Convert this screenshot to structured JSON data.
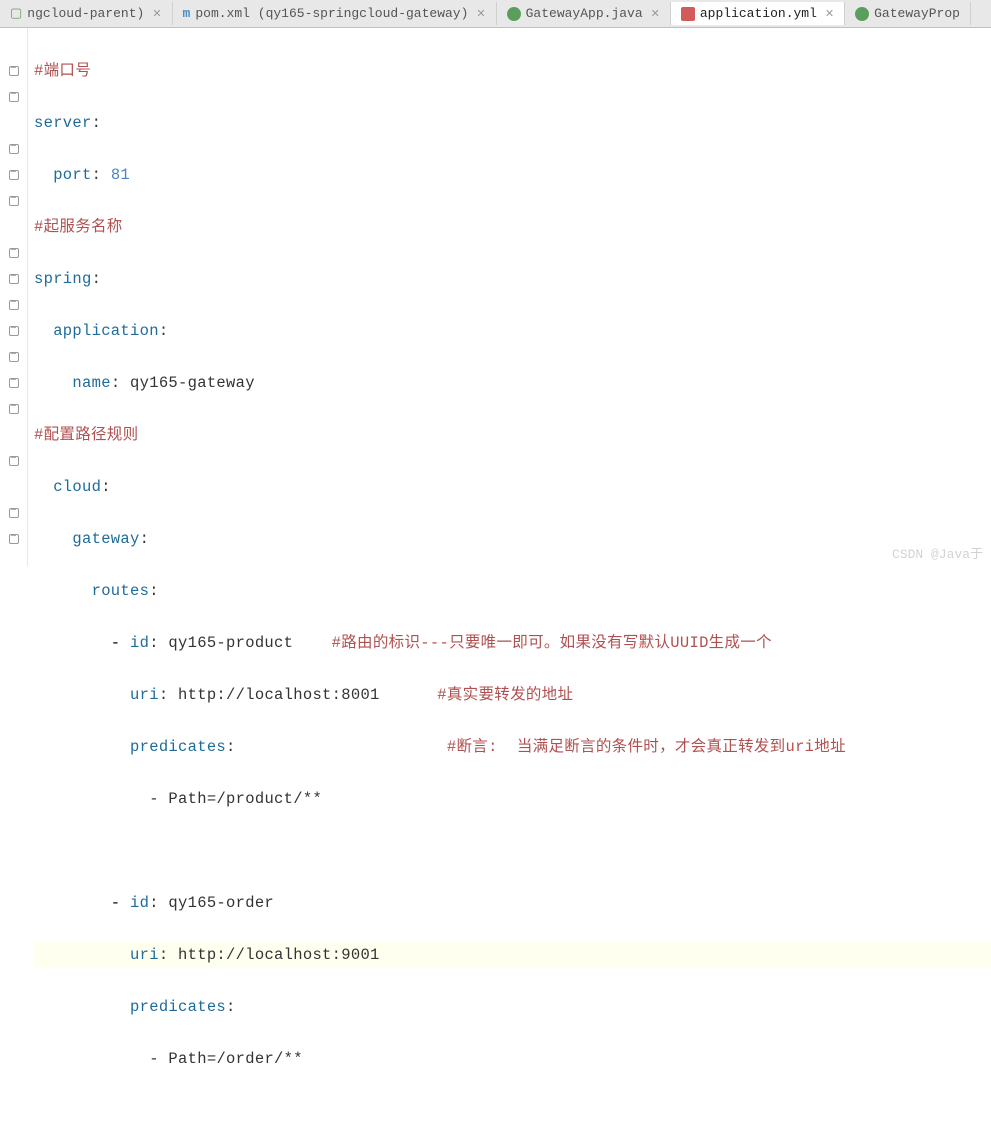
{
  "tabs": [
    {
      "label": "ngcloud-parent)",
      "icon": "module"
    },
    {
      "label": "pom.xml (qy165-springcloud-gateway)",
      "icon": "maven"
    },
    {
      "label": "GatewayApp.java",
      "icon": "java"
    },
    {
      "label": "application.yml",
      "icon": "yaml",
      "active": true
    },
    {
      "label": "GatewayProp",
      "icon": "java"
    }
  ],
  "code": {
    "comment1": "#端口号",
    "server_key": "server",
    "port_key": "port",
    "port_value": "81",
    "comment2": "#起服务名称",
    "spring_key": "spring",
    "application_key": "application",
    "name_key": "name",
    "name_value": "qy165-gateway",
    "comment3": "#配置路径规则",
    "cloud_key": "cloud",
    "gateway_key": "gateway",
    "routes_key": "routes",
    "id_key": "id",
    "route1_id": "qy165-product",
    "route1_comment": "#路由的标识---只要唯一即可。如果没有写默认UUID生成一个",
    "uri_key": "uri",
    "route1_uri": "http://localhost:8001",
    "route1_uri_comment": "#真实要转发的地址",
    "predicates_key": "predicates",
    "predicates_comment": "#断言:  当满足断言的条件时，才会真正转发到uri地址",
    "path_key": "Path",
    "route1_path": "/product/**",
    "route2_id": "qy165-order",
    "route2_uri": "http://localhost:9001",
    "route2_path": "/order/**"
  },
  "watermark": "CSDN @Java于"
}
